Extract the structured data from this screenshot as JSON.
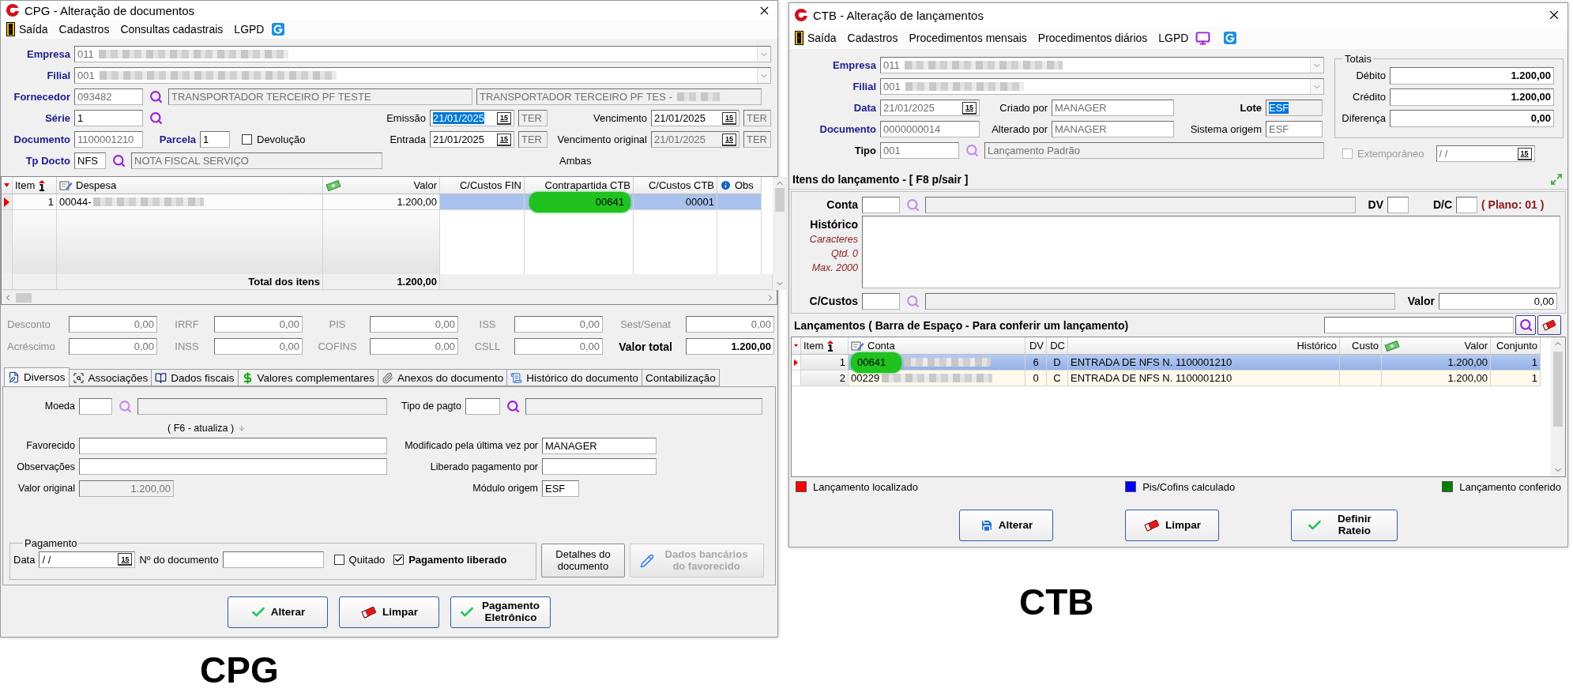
{
  "cpg": {
    "title": "CPG - Alteração de documentos",
    "menu": [
      {
        "label": "Saída",
        "kind": "exit"
      },
      {
        "label": "Cadastros",
        "kind": "text"
      },
      {
        "label": "Consultas cadastrais",
        "kind": "text"
      },
      {
        "label": "LGPD",
        "kind": "text"
      }
    ],
    "empresa": {
      "label": "Empresa",
      "value": "011"
    },
    "filial": {
      "label": "Filial",
      "value": "001"
    },
    "fornecedor": {
      "label": "Fornecedor",
      "code": "093482",
      "name": "TRANSPORTADOR TERCEIRO PF TESTE",
      "name_2": "TRANSPORTADOR TERCEIRO PF TES -"
    },
    "serie": {
      "label": "Série",
      "value": "1"
    },
    "documento": {
      "label": "Documento",
      "value": "1100001210"
    },
    "parcela": {
      "label": "Parcela",
      "value": "1"
    },
    "devolucao": {
      "label": "Devolução",
      "checked": false
    },
    "tp_docto": {
      "label": "Tp Docto",
      "code": "NFS",
      "name": "NOTA FISCAL SERVIÇO"
    },
    "dates": [
      {
        "label": "Emissão",
        "value": "21/01/2025",
        "calendar": "15",
        "weekday": "TER",
        "selected": true,
        "disabled": false
      },
      {
        "label": "Vencimento",
        "value": "21/01/2025",
        "calendar": "15",
        "weekday": "TER",
        "selected": false,
        "disabled": false
      },
      {
        "label": "Entrada",
        "value": "21/01/2025",
        "calendar": "15",
        "weekday": "TER",
        "selected": false,
        "disabled": false
      },
      {
        "label": "Vencimento original",
        "value": "21/01/2025",
        "calendar": "15",
        "weekday": "TER",
        "selected": false,
        "disabled": true
      }
    ],
    "ambas": "Ambas",
    "items_grid": {
      "columns": [
        {
          "label": "Item",
          "kind": "sort"
        },
        {
          "label": "Despesa",
          "kind": "edit"
        },
        {
          "label": "Valor",
          "kind": "money"
        },
        {
          "label": "C/Custos FIN",
          "kind": "plain"
        },
        {
          "label": "Contrapartida CTB",
          "kind": "plain"
        },
        {
          "label": "C/Custos CTB",
          "kind": "plain"
        },
        {
          "label": "Obs",
          "kind": "info"
        }
      ],
      "rows": [
        {
          "selected": true,
          "cells": [
            {
              "text": "1"
            },
            {
              "text": "00044-",
              "blurred": true
            },
            {
              "text": "1.200,00"
            },
            null,
            {
              "text": "00641",
              "highlighted": true
            },
            {
              "text": "00001"
            },
            null
          ]
        }
      ],
      "total": {
        "label": "Total dos itens",
        "value": "1.200,00"
      }
    },
    "taxes": [
      {
        "label": "Desconto",
        "value": "0,00",
        "kind": "tax"
      },
      {
        "label": "IRRF",
        "value": "0,00",
        "kind": "tax"
      },
      {
        "label": "PIS",
        "value": "0,00",
        "kind": "tax"
      },
      {
        "label": "ISS",
        "value": "0,00",
        "kind": "tax"
      },
      {
        "label": "Sest/Senat",
        "value": "0,00",
        "kind": "tax"
      },
      {
        "label": "Acréscimo",
        "value": "0,00",
        "kind": "tax"
      },
      {
        "label": "INSS",
        "value": "0,00",
        "kind": "tax"
      },
      {
        "label": "COFINS",
        "value": "0,00",
        "kind": "tax"
      },
      {
        "label": "CSLL",
        "value": "0,00",
        "kind": "tax"
      },
      {
        "label": "Valor total",
        "value": "1.200,00",
        "kind": "total"
      }
    ],
    "tabs": [
      {
        "label": "Diversos",
        "selected": true
      },
      {
        "label": "Associações",
        "selected": false
      },
      {
        "label": "Dados fiscais",
        "selected": false
      },
      {
        "label": "Valores complementares",
        "selected": false
      },
      {
        "label": "Anexos do documento",
        "selected": false
      },
      {
        "label": "Histórico do documento",
        "selected": false
      },
      {
        "label": "Contabilização",
        "selected": false
      }
    ],
    "diversos": {
      "moeda": {
        "label": "Moeda"
      },
      "tipo_pagto": {
        "label": "Tipo de pagto"
      },
      "hint": "( F6 - atualiza )",
      "favorecido": {
        "label": "Favorecido"
      },
      "observacoes": {
        "label": "Observações"
      },
      "valor_original": {
        "label": "Valor original",
        "value": "1.200,00"
      },
      "modificado_por": {
        "label": "Modificado pela última vez por",
        "value": "MANAGER"
      },
      "liberado_por": {
        "label": "Liberado pagamento por"
      },
      "modulo_origem": {
        "label": "Módulo origem",
        "value": "ESF"
      }
    },
    "pagamento": {
      "title": "Pagamento",
      "data_label": "Data",
      "data_value": "/ /",
      "calendar": "15",
      "documento_label": "Nº do documento",
      "checks": [
        {
          "label": "Quitado",
          "checked": false
        },
        {
          "label": "Pagamento liberado",
          "checked": true
        }
      ]
    },
    "side_buttons": [
      {
        "label": "Detalhes do documento",
        "kind": "plain",
        "disabled": false
      },
      {
        "label": "Dados bancários do favorecido",
        "kind": "pencil",
        "disabled": true
      }
    ],
    "buttons": [
      {
        "label": "Alterar",
        "kind": "check"
      },
      {
        "label": "Limpar",
        "kind": "eraser"
      },
      {
        "label": "Pagamento Eletrônico",
        "kind": "check"
      }
    ],
    "caption": "CPG"
  },
  "ctb": {
    "title": "CTB - Alteração de lançamentos",
    "menu": [
      {
        "label": "Saída",
        "kind": "exit"
      },
      {
        "label": "Cadastros",
        "kind": "text"
      },
      {
        "label": "Procedimentos mensais",
        "kind": "text"
      },
      {
        "label": "Procedimentos diários",
        "kind": "text"
      },
      {
        "label": "LGPD",
        "kind": "text"
      }
    ],
    "empresa": {
      "label": "Empresa",
      "value": "011"
    },
    "filial": {
      "label": "Filial",
      "value": "001"
    },
    "data": {
      "label": "Data",
      "value": "21/01/2025",
      "calendar": "15"
    },
    "criado_por": {
      "label": "Criado por",
      "value": "MANAGER"
    },
    "lote": {
      "label": "Lote",
      "value": "ESF",
      "highlighted": true
    },
    "documento": {
      "label": "Documento",
      "value": "0000000014"
    },
    "alterado_por": {
      "label": "Alterado por",
      "value": "MANAGER"
    },
    "sistema_origem": {
      "label": "Sistema origem",
      "value": "ESF"
    },
    "tipo": {
      "label": "Tipo",
      "code": "001",
      "name": "Lançamento Padrão"
    },
    "totais": {
      "title": "Totais",
      "rows": [
        {
          "label": "Débito",
          "value": "1.200,00"
        },
        {
          "label": "Crédito",
          "value": "1.200,00"
        },
        {
          "label": "Diferença",
          "value": "0,00"
        }
      ]
    },
    "extemporaneo": {
      "label": "Extemporâneo",
      "checked": false,
      "disabled": true,
      "date": "/ /",
      "calendar": "15"
    },
    "itens_title": "Itens do lançamento - [ F8 p/sair ]",
    "conta": {
      "label": "Conta"
    },
    "dv": {
      "label": "DV"
    },
    "dc": {
      "label": "D/C"
    },
    "plano": "( Plano: 01 )",
    "historico": {
      "label": "Histórico",
      "notes": [
        "Caracteres",
        "Qtd. 0",
        "Max. 2000"
      ]
    },
    "ccustos": {
      "label": "C/Custos"
    },
    "valor": {
      "label": "Valor",
      "value": "0,00"
    },
    "lancamentos_title": "Lançamentos ( Barra de Espaço - Para conferir um lançamento)",
    "grid": {
      "columns": [
        {
          "label": "Item",
          "kind": "sort"
        },
        {
          "label": "Conta",
          "kind": "edit"
        },
        {
          "label": "DV",
          "kind": "plain"
        },
        {
          "label": "DC",
          "kind": "plain"
        },
        {
          "label": "Histórico",
          "kind": "plain"
        },
        {
          "label": "Custo",
          "kind": "plain"
        },
        {
          "label": "Valor",
          "kind": "money"
        },
        {
          "label": "Conjunto",
          "kind": "plain"
        }
      ],
      "rows": [
        {
          "selected": true,
          "cells": [
            {
              "text": "1"
            },
            {
              "text": "00641",
              "highlighted": true,
              "blurred": true
            },
            {
              "text": "6"
            },
            {
              "text": "D"
            },
            {
              "text": "ENTRADA DE NFS N. 1100001210"
            },
            null,
            {
              "text": "1.200,00"
            },
            {
              "text": "1"
            }
          ]
        },
        {
          "selected": false,
          "cells": [
            {
              "text": "2"
            },
            {
              "text": "00229",
              "blurred": true
            },
            {
              "text": "0"
            },
            {
              "text": "C"
            },
            {
              "text": "ENTRADA DE NFS N. 1100001210"
            },
            null,
            {
              "text": "1.200,00"
            },
            {
              "text": "1"
            }
          ]
        }
      ]
    },
    "legend": [
      {
        "label": "Lançamento localizado",
        "color": "#ff0000"
      },
      {
        "label": "Pis/Cofins calculado",
        "color": "#0000ff"
      },
      {
        "label": "Lançamento conferido",
        "color": "#008000"
      }
    ],
    "buttons": [
      {
        "label": "Alterar",
        "kind": "save"
      },
      {
        "label": "Limpar",
        "kind": "eraser"
      },
      {
        "label": "Definir Rateio",
        "kind": "check"
      }
    ],
    "caption": "CTB"
  }
}
